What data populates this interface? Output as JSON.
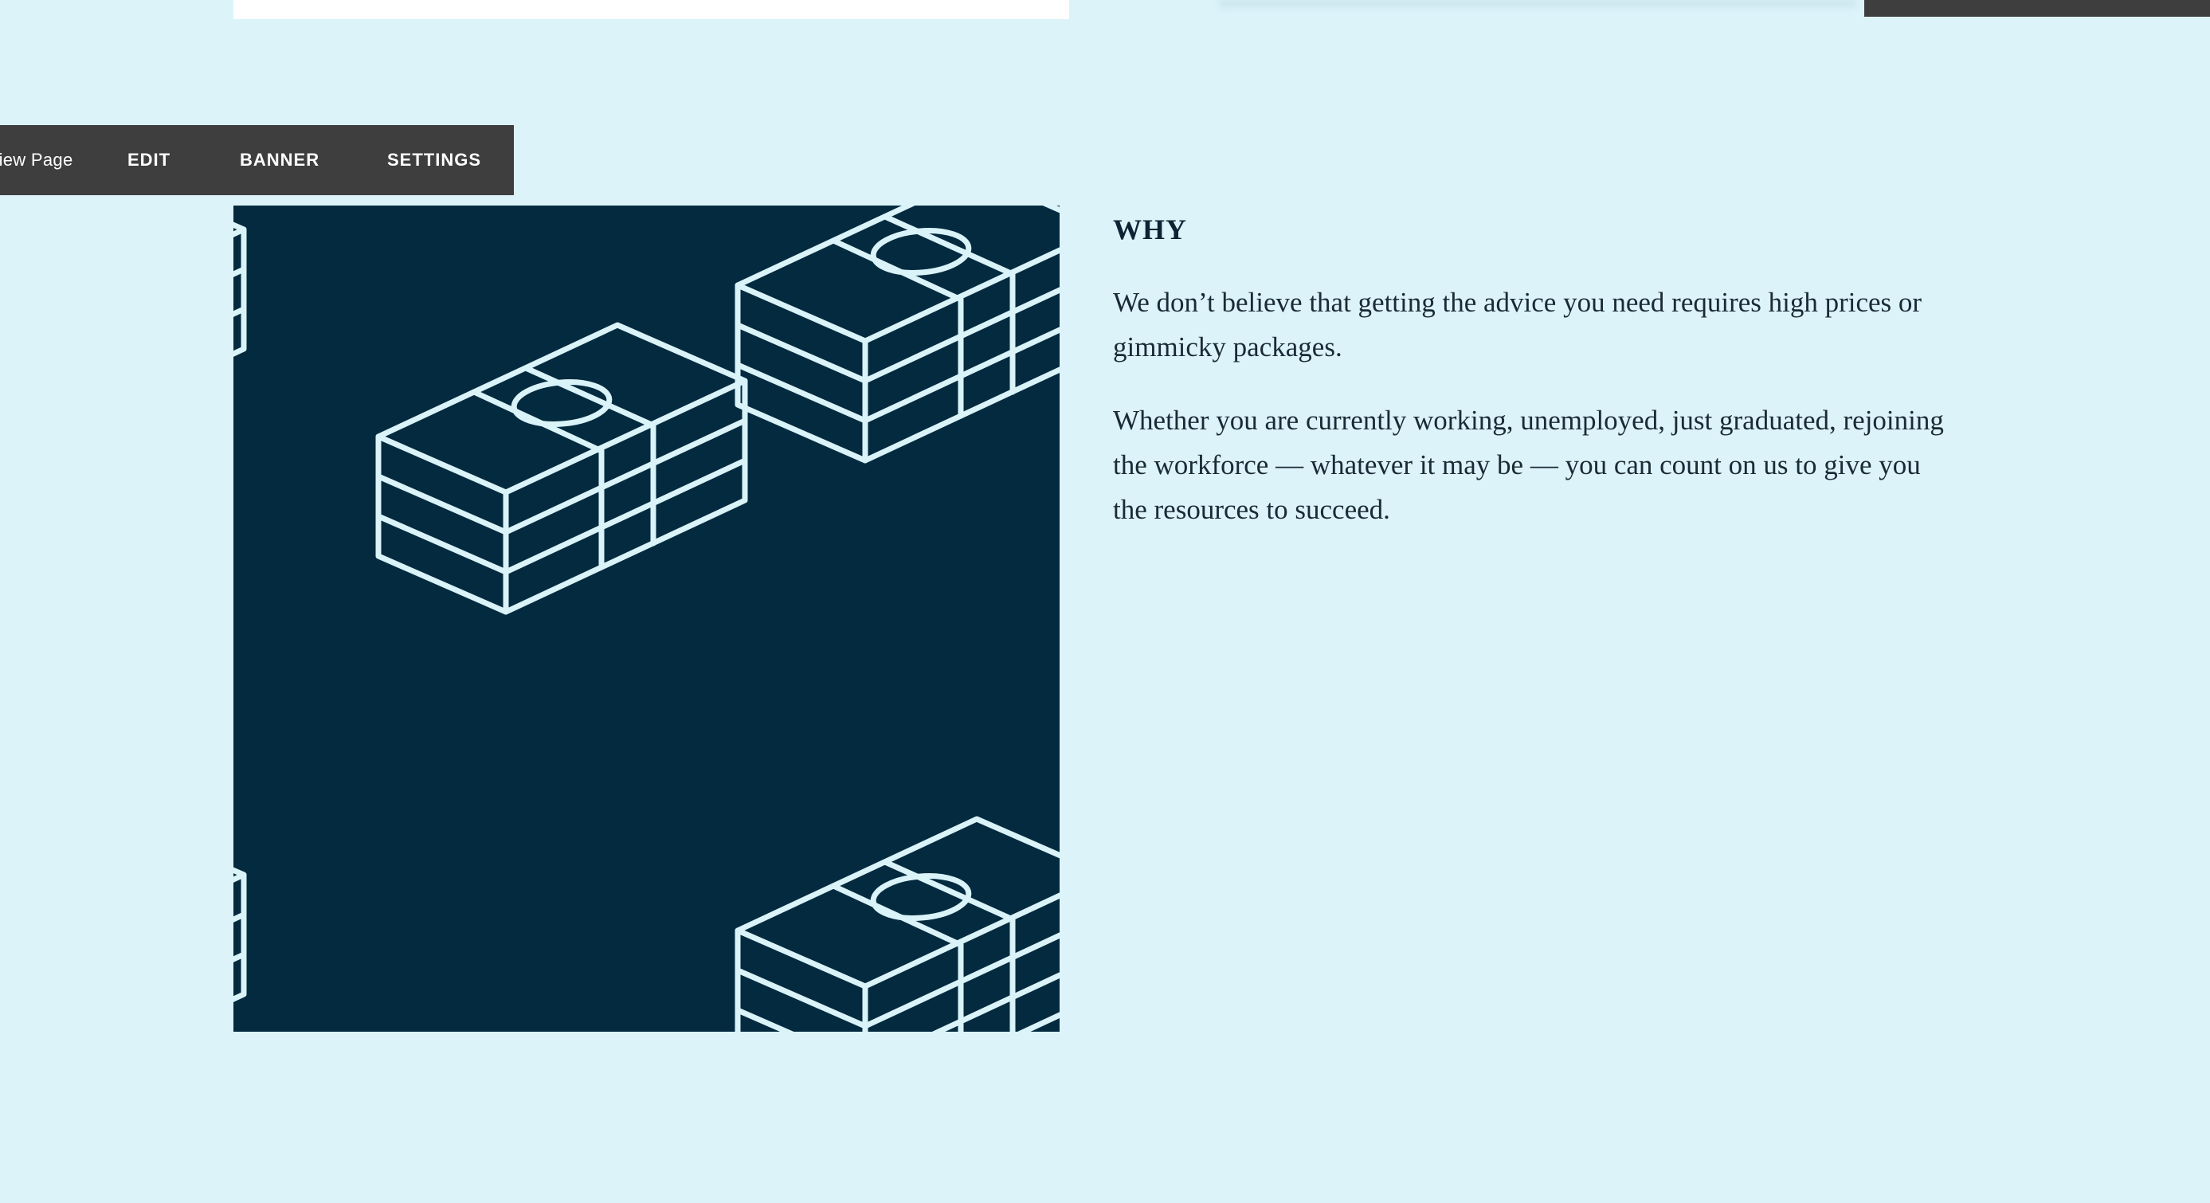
{
  "editor_toolbar": {
    "view_page_label": "View Page",
    "edit_label": "EDIT",
    "banner_label": "BANNER",
    "settings_label": "SETTINGS"
  },
  "section": {
    "heading": "WHY",
    "paragraph_1": "We don’t believe that getting the advice you need requires high prices or gimmicky packages.",
    "paragraph_2": "Whether you are currently working, unemployed, just graduated, rejoining the workforce — whatever it may be — you can count on us to give you the resources to succeed."
  },
  "image": {
    "description_icon": "money-stack-icon",
    "background_color": "#032a3e",
    "line_color": "#d9f3f8"
  },
  "colors": {
    "page_background": "#dcf3fa",
    "toolbar_background": "#3f3e3f",
    "text": "#0c2433"
  }
}
